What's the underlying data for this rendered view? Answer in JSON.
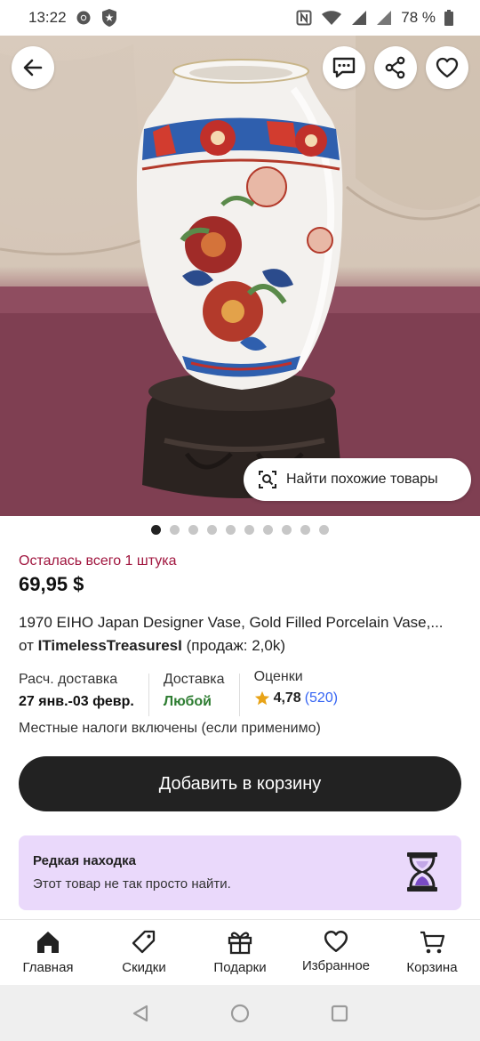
{
  "status": {
    "time": "13:22",
    "battery": "78 %"
  },
  "hero": {
    "similar_label": "Найти похожие товары",
    "page_count": 10,
    "active_page": 1
  },
  "product": {
    "stock_note": "Осталась всего 1 штука",
    "price": "69,95 $",
    "title": "1970 EIHO Japan Designer Vase, Gold Filled Porcelain Vase,...",
    "seller_prefix": "от",
    "seller_name": "ITimelessTreasuresI",
    "seller_sales": "(продаж: 2,0k)"
  },
  "info": {
    "shipping_label": "Расч. доставка",
    "shipping_value": "27 янв.-03 февр.",
    "delivery_label": "Доставка",
    "delivery_value": "Любой",
    "ratings_label": "Оценки",
    "rating_value": "4,78",
    "rating_count": "(520)",
    "taxes": "Местные налоги включены (если применимо)"
  },
  "actions": {
    "add_to_cart": "Добавить в корзину"
  },
  "rare": {
    "title": "Редкая находка",
    "subtitle": "Этот товар не так просто найти."
  },
  "nav": {
    "items": [
      {
        "label": "Главная",
        "icon": "home-icon"
      },
      {
        "label": "Скидки",
        "icon": "tag-icon"
      },
      {
        "label": "Подарки",
        "icon": "gift-icon"
      },
      {
        "label": "Избранное",
        "icon": "heart-icon"
      },
      {
        "label": "Корзина",
        "icon": "cart-icon"
      }
    ]
  },
  "colors": {
    "stock_red": "#a0153e",
    "delivery_green": "#2e7d32",
    "rating_star": "#e8a317",
    "rating_link": "#3665f3",
    "primary_button": "#222222",
    "rare_bg": "#ead9fb",
    "hourglass_purple": "#7a4bc4"
  }
}
